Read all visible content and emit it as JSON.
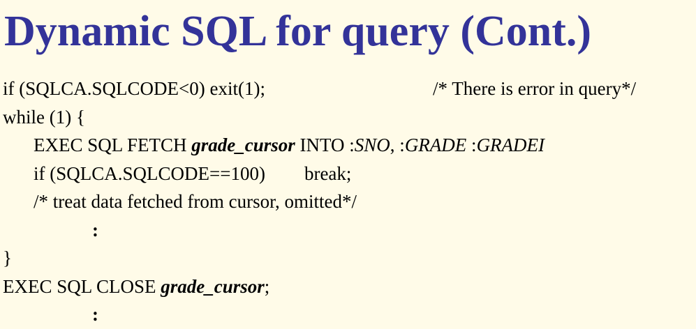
{
  "slide": {
    "title": "Dynamic SQL for query (Cont.)",
    "colors": {
      "title": "#333399",
      "background": "#fffbe8",
      "text": "#000000"
    }
  },
  "code": {
    "l1_stmt": "if (SQLCA.SQLCODE<0) exit(1);",
    "l1_comment": "/* There is error in query*/",
    "l2": "while (1) {",
    "l3_a": "EXEC SQL FETCH ",
    "l3_cursor": "grade_cursor",
    "l3_b": " INTO :",
    "l3_sno": "SNO",
    "l3_c": ", :",
    "l3_grade": "GRADE",
    "l3_d": " :",
    "l3_gradei": "GRADEI",
    "l4_a": "if (SQLCA.SQLCODE==100)",
    "l4_b": "break;",
    "l5": "/* treat data fetched from cursor, omitted*/",
    "l6": ":",
    "l7": "}",
    "l8_a": "EXEC SQL CLOSE ",
    "l8_cursor": "grade_cursor",
    "l8_b": ";",
    "l9": ":"
  }
}
